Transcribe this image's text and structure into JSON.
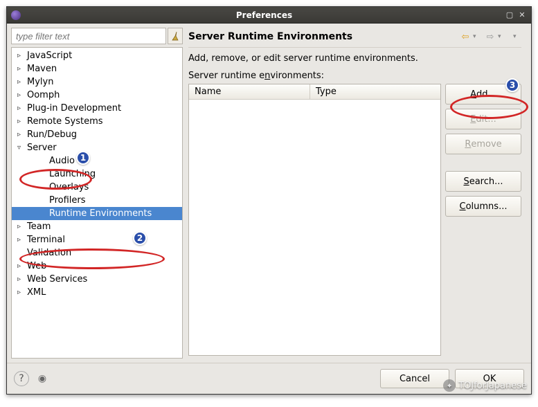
{
  "window": {
    "title": "Preferences"
  },
  "filter": {
    "placeholder": "type filter text"
  },
  "tree": {
    "items": [
      {
        "label": "JavaScript",
        "expandable": true,
        "expanded": false,
        "child": false
      },
      {
        "label": "Maven",
        "expandable": true,
        "expanded": false,
        "child": false
      },
      {
        "label": "Mylyn",
        "expandable": true,
        "expanded": false,
        "child": false
      },
      {
        "label": "Oomph",
        "expandable": true,
        "expanded": false,
        "child": false
      },
      {
        "label": "Plug-in Development",
        "expandable": true,
        "expanded": false,
        "child": false
      },
      {
        "label": "Remote Systems",
        "expandable": true,
        "expanded": false,
        "child": false
      },
      {
        "label": "Run/Debug",
        "expandable": true,
        "expanded": false,
        "child": false
      },
      {
        "label": "Server",
        "expandable": true,
        "expanded": true,
        "child": false
      },
      {
        "label": "Audio",
        "expandable": false,
        "child": true
      },
      {
        "label": "Launching",
        "expandable": false,
        "child": true
      },
      {
        "label": "Overlays",
        "expandable": false,
        "child": true
      },
      {
        "label": "Profilers",
        "expandable": false,
        "child": true
      },
      {
        "label": "Runtime Environments",
        "expandable": false,
        "child": true,
        "selected": true
      },
      {
        "label": "Team",
        "expandable": true,
        "expanded": false,
        "child": false
      },
      {
        "label": "Terminal",
        "expandable": true,
        "expanded": false,
        "child": false
      },
      {
        "label": "Validation",
        "expandable": false,
        "child": false
      },
      {
        "label": "Web",
        "expandable": true,
        "expanded": false,
        "child": false
      },
      {
        "label": "Web Services",
        "expandable": true,
        "expanded": false,
        "child": false
      },
      {
        "label": "XML",
        "expandable": true,
        "expanded": false,
        "child": false
      }
    ]
  },
  "page": {
    "title": "Server Runtime Environments",
    "description": "Add, remove, or edit server runtime environments.",
    "table_label": "Server runtime environments:",
    "columns": {
      "name": "Name",
      "type": "Type"
    }
  },
  "buttons": {
    "add": "Add...",
    "edit": "Edit...",
    "remove": "Remove",
    "search": "Search...",
    "columns": "Columns..."
  },
  "footer": {
    "cancel": "Cancel",
    "ok": "OK"
  },
  "annotations": {
    "badge1": "1",
    "badge2": "2",
    "badge3": "3"
  },
  "watermark": {
    "text": "TOJforJapanese"
  }
}
